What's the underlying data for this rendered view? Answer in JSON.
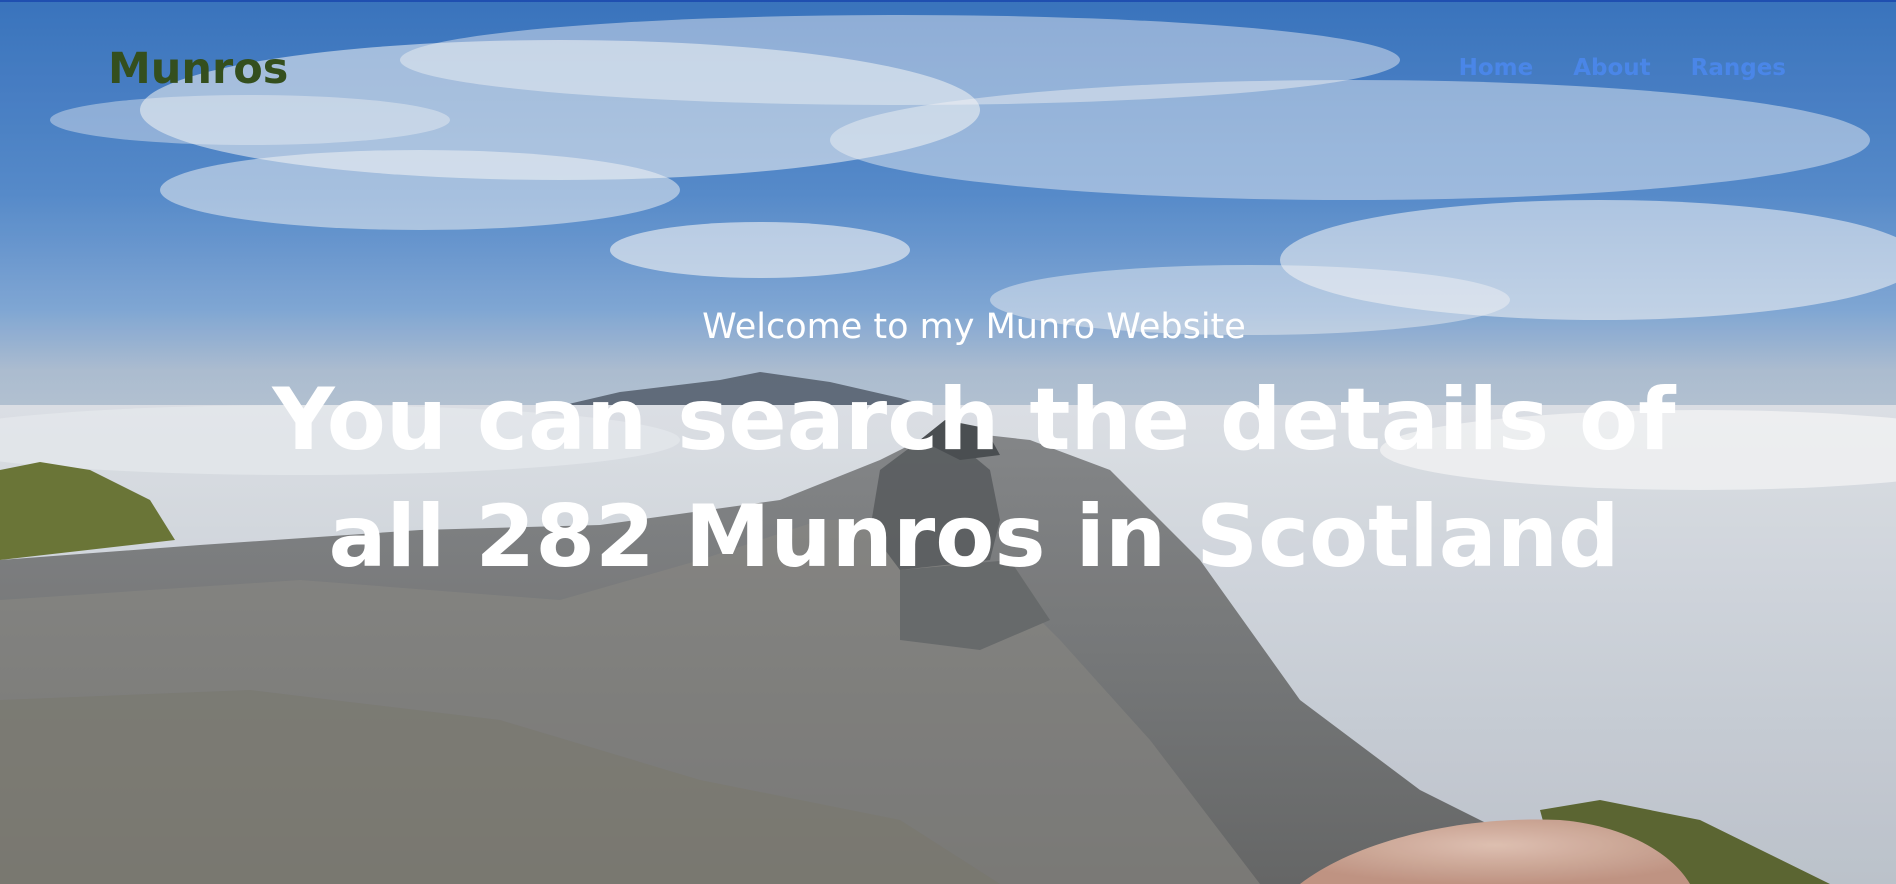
{
  "header": {
    "brand": "Munros",
    "nav": [
      {
        "label": "Home"
      },
      {
        "label": "About"
      },
      {
        "label": "Ranges"
      }
    ]
  },
  "hero": {
    "welcome": "Welcome to my Munro Website",
    "headline": "You can search the details of all 282 Munros in Scotland",
    "background": "photo of a rocky summit cairn above a sea of cloud under a blue sky"
  },
  "colors": {
    "brand": "#344f1e",
    "nav_link": "#4a86e8",
    "hero_text": "#ffffff",
    "top_rule": "#1f4fb0"
  }
}
